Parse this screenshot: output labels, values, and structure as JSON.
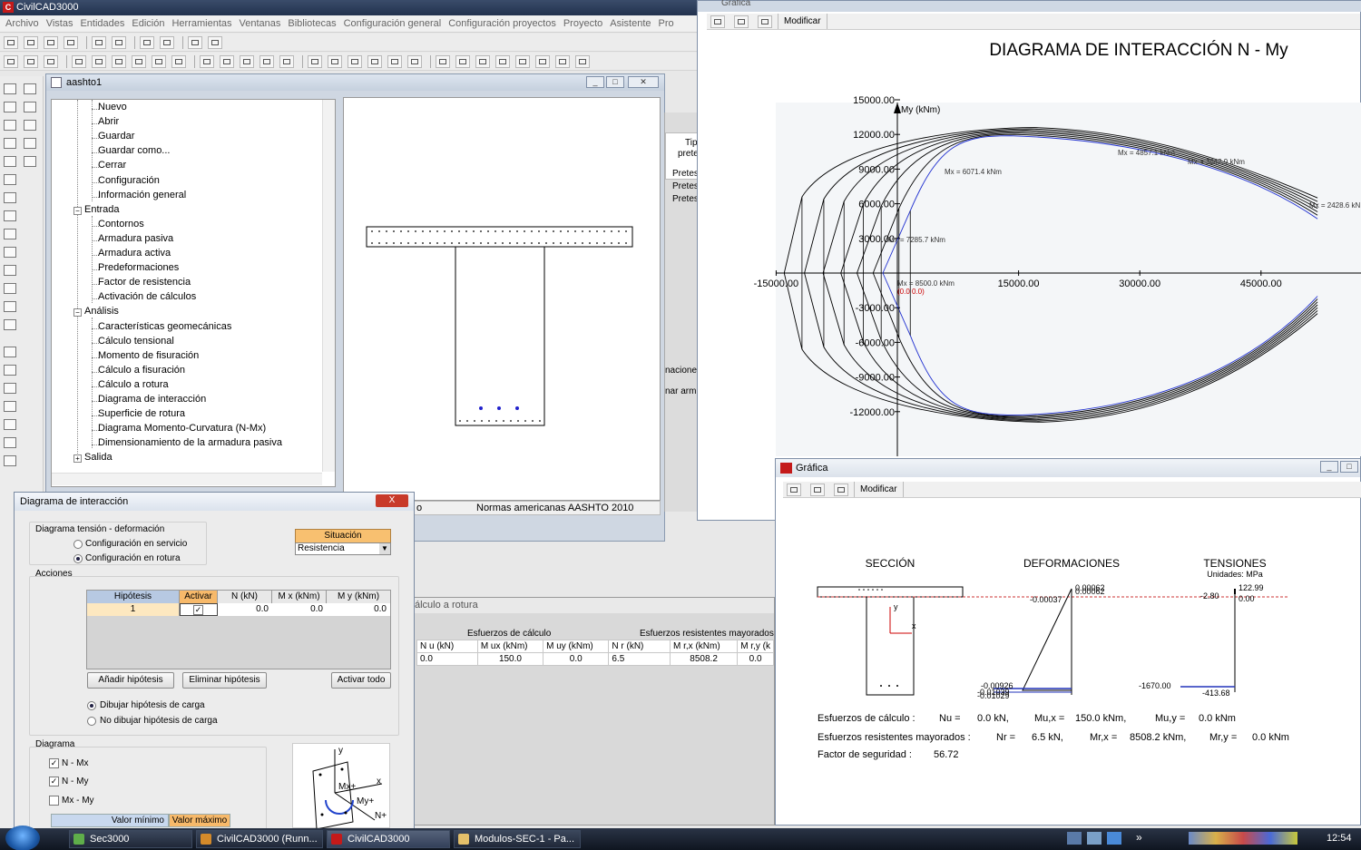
{
  "app": {
    "title": "CivilCAD3000",
    "menu": [
      "Archivo",
      "Vistas",
      "Entidades",
      "Edición",
      "Herramientas",
      "Ventanas",
      "Bibliotecas",
      "Configuración general",
      "Configuración proyectos",
      "Proyecto",
      "Asistente",
      "Pro"
    ]
  },
  "child_window": {
    "title": "aashto1",
    "status": "Normas americanas  AASHTO 2010",
    "status_left": "o"
  },
  "tree": {
    "items": [
      {
        "label": "Nuevo"
      },
      {
        "label": "Abrir"
      },
      {
        "label": "Guardar"
      },
      {
        "label": "Guardar como..."
      },
      {
        "label": "Cerrar"
      },
      {
        "label": "Configuración"
      },
      {
        "label": "Información general"
      },
      {
        "label": "Entrada",
        "expander": "−"
      },
      {
        "label": "Contornos"
      },
      {
        "label": "Armadura pasiva"
      },
      {
        "label": "Armadura activa"
      },
      {
        "label": "Predeformaciones"
      },
      {
        "label": "Factor de resistencia"
      },
      {
        "label": "Activación de cálculos"
      },
      {
        "label": "Análisis",
        "expander": "−"
      },
      {
        "label": "Características geomecánicas"
      },
      {
        "label": "Cálculo tensional"
      },
      {
        "label": "Momento de fisuración"
      },
      {
        "label": "Cálculo a fisuración"
      },
      {
        "label": "Cálculo a rotura"
      },
      {
        "label": "Diagrama de interacción"
      },
      {
        "label": "Superficie de rotura"
      },
      {
        "label": "Diagrama Momento-Curvatura (N-Mx)"
      },
      {
        "label": "Dimensionamiento de la armadura pasiva"
      },
      {
        "label": "Salida",
        "expander": "+"
      }
    ]
  },
  "bg_panel": {
    "partial_labels": [
      "Tip",
      "prete",
      "Pretes",
      "Pretes",
      "Pretes",
      "naciones",
      "nar arm"
    ],
    "calc_title": "álculo a rotura",
    "group1": "Esfuerzos de cálculo",
    "group2": "Esfuerzos resistentes mayorados",
    "headers": [
      "N u (kN)",
      "M ux (kNm)",
      "M uy (kNm)",
      "N r (kN)",
      "M r,x (kNm)",
      "M r,y (k"
    ],
    "row": [
      "0.0",
      "150.0",
      "0.0",
      "6.5",
      "8508.2",
      "0.0"
    ]
  },
  "dialog": {
    "title": "Diagrama de interacción",
    "close": "X",
    "tension_group": "Diagrama tensión - deformación",
    "radio_servicio": "Configuración en servicio",
    "radio_rotura": "Configuración en rotura",
    "situacion_label": "Situación",
    "situacion_value": "Resistencia",
    "acciones": "Acciones",
    "grid_headers": [
      "Hipótesis",
      "Activar",
      "N (kN)",
      "M x (kNm)",
      "M y (kNm)"
    ],
    "grid_row": [
      "1",
      "✓",
      "0.0",
      "0.0",
      "0.0"
    ],
    "btn_add": "Añadir hipótesis",
    "btn_delete": "Eliminar hipótesis",
    "btn_all": "Activar todo",
    "radio_draw": "Dibujar hipótesis de carga",
    "radio_nodraw": "No dibujar hipótesis de carga",
    "diagrama": "Diagrama",
    "chk_nmx": "N - Mx",
    "chk_nmy": "N - My",
    "chk_mxmy": "Mx - My",
    "min_label": "Valor mínimo",
    "max_label": "Valor máximo",
    "axes_labels": {
      "y": "y",
      "x": "x",
      "mx": "Mx+",
      "my": "My+",
      "n": "N+"
    }
  },
  "graph1": {
    "window_title": "Gráfica",
    "modify": "Modificar",
    "title": "DIAGRAMA DE INTERACCIÓN N - My",
    "ylabel": "My (kNm)",
    "xticks": [
      "-15000.00",
      "15000.00",
      "30000.00",
      "45000.00"
    ],
    "yticks": [
      "15000.00",
      "12000.00",
      "9000.00",
      "6000.00",
      "3000.00",
      "-3000.00",
      "-6000.00",
      "-9000.00",
      "-12000.00"
    ],
    "annotations": [
      "Mx = 4857.1 kNm",
      "Mx = 3642.9 kNm",
      "Mx = 6071.4 kNm",
      "Mx = 2428.6 kN",
      "Mx = 7285.7 kNm",
      "Mx = 8500.0 kNm",
      "(0.0  0.0)"
    ]
  },
  "graph2": {
    "window_title": "Gráfica",
    "modify": "Modificar",
    "sec_title": "SECCIÓN",
    "def_title": "DEFORMACIONES",
    "ten_title": "TENSIONES",
    "units": "Unidades:  MPa",
    "def_top": "0.00062",
    "def_top2": "0.00062",
    "def_neutral": "-0.00037",
    "def_bot1": "-0.00926",
    "def_bot2": "-0.01039",
    "def_bot3": "-0.01029",
    "ten_top": "122.99",
    "ten_top2": "0.00",
    "ten_left": "-2.80",
    "ten_bot1": "-1670.00",
    "ten_bot2": "-413.68",
    "axis_y": "y",
    "axis_x": "x",
    "line1": {
      "label": "Esfuerzos de cálculo :",
      "a": "Nu =",
      "av": "0.0  kN,",
      "b": "Mu,x =",
      "bv": "150.0  kNm,",
      "c": "Mu,y =",
      "cv": "0.0  kNm"
    },
    "line2": {
      "label": "Esfuerzos resistentes mayorados :",
      "a": "Nr =",
      "av": "6.5  kN,",
      "b": "Mr,x =",
      "bv": "8508.2  kNm,",
      "c": "Mr,y =",
      "cv": "0.0  kNm"
    },
    "line3": {
      "label": "Factor de seguridad :",
      "v": "56.72"
    }
  },
  "taskbar": {
    "tasks": [
      "Sec3000",
      "CivilCAD3000 (Runn...",
      "CivilCAD3000",
      "Modulos-SEC-1 - Pa..."
    ],
    "clock": "12:54",
    "chevrons": "»"
  }
}
